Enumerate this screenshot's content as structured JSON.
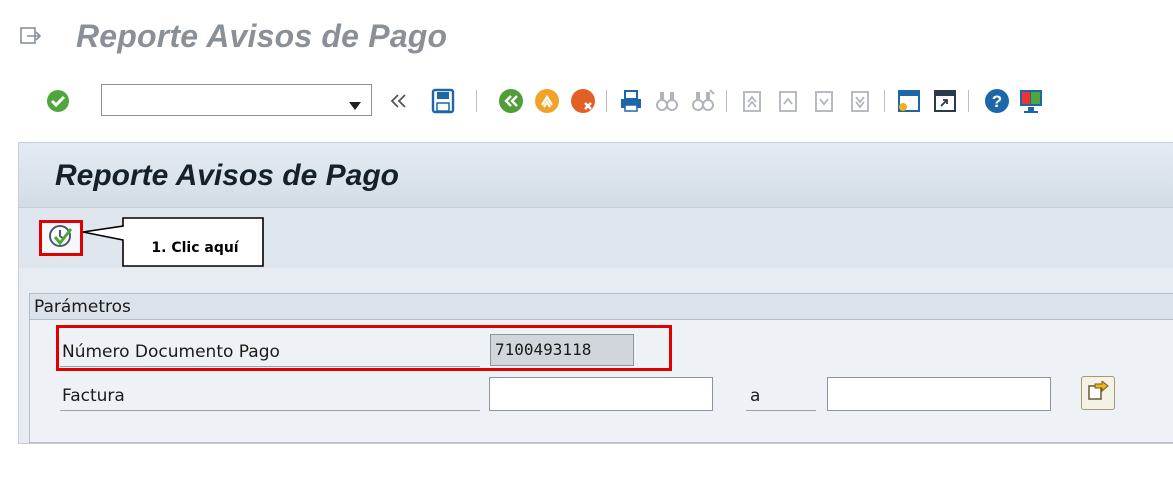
{
  "window": {
    "title": "Reporte Avisos de Pago"
  },
  "toolbar": {
    "command_field": {
      "value": "",
      "placeholder": ""
    },
    "icons": [
      "check-icon",
      "collapse-icon",
      "save-icon",
      "back-icon",
      "exit-icon",
      "cancel-icon",
      "print-icon",
      "find-icon",
      "find-next-icon",
      "first-page-icon",
      "previous-page-icon",
      "next-page-icon",
      "last-page-icon",
      "new-session-icon",
      "shortcut-icon",
      "help-icon",
      "layout-icon"
    ]
  },
  "panel": {
    "title": "Reporte Avisos de Pago",
    "execute_icon": "execute-icon",
    "callout": "1. Clic aquí"
  },
  "params": {
    "section_title": "Parámetros",
    "doc_label": "Número Documento Pago",
    "doc_value": "7100493118",
    "invoice_label": "Factura",
    "invoice_from": "",
    "to_label": "a",
    "invoice_to": "",
    "multiple_selection_icon": "multiple-selection-icon"
  },
  "colors": {
    "highlight": "#e00000",
    "title_gray": "#8a9098",
    "panel_bg": "#e7ecf2"
  }
}
